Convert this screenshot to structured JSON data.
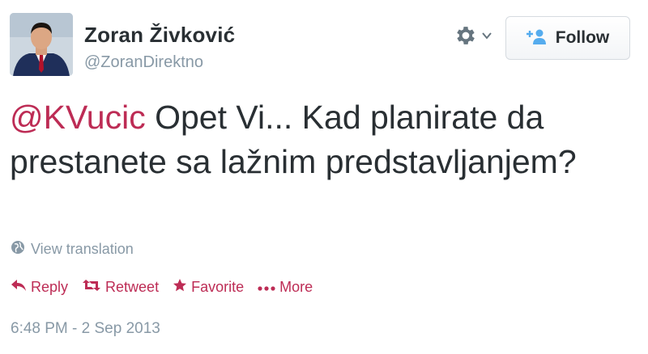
{
  "author": {
    "full_name": "Zoran Živković",
    "username": "@ZoranDirektno"
  },
  "follow_button": {
    "label": "Follow"
  },
  "tweet": {
    "mention": "@KVucic",
    "text": " Opet Vi... Kad planirate da prestanete sa lažnim predstavljanjem?"
  },
  "translation_link": {
    "label": "View translation",
    "icon": "globe-icon"
  },
  "actions": [
    {
      "label": "Reply",
      "icon": "reply-icon"
    },
    {
      "label": "Retweet",
      "icon": "retweet-icon"
    },
    {
      "label": "Favorite",
      "icon": "star-icon"
    },
    {
      "label": "More",
      "icon": "more-dots-icon"
    }
  ],
  "timestamp": "6:48 PM - 2 Sep 2013",
  "colors": {
    "accent": "#bd2c55",
    "text": "#292f33",
    "muted": "#8899a6"
  }
}
